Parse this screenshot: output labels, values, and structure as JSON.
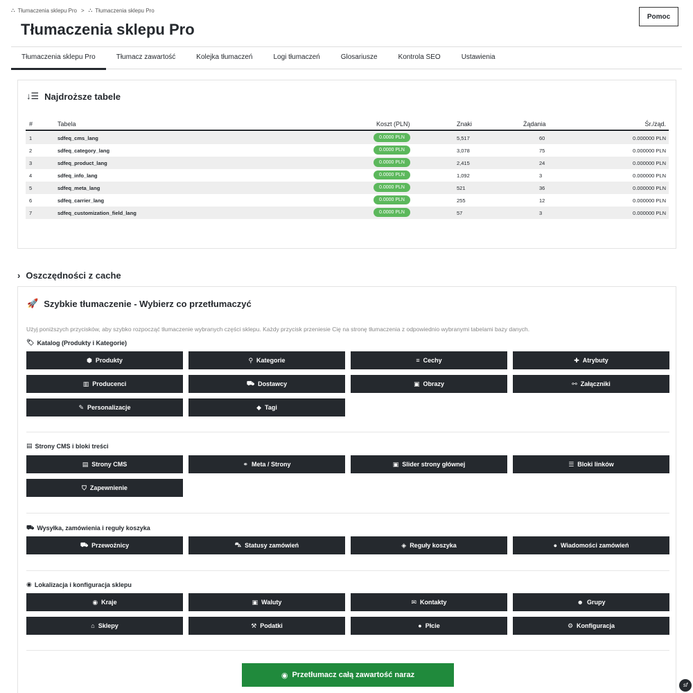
{
  "breadcrumb": [
    "Tłumaczenia sklepu Pro",
    "Tłumaczenia sklepu Pro"
  ],
  "title": "Tłumaczenia sklepu Pro",
  "help_label": "Pomoc",
  "tabs": [
    "Tłumaczenia sklepu Pro",
    "Tłumacz zawartość",
    "Kolejka tłumaczeń",
    "Logi tłumaczeń",
    "Glosariusze",
    "Kontrola SEO",
    "Ustawienia"
  ],
  "expensive": {
    "heading": "Najdroższe tabele",
    "columns": [
      "#",
      "Tabela",
      "Koszt (PLN)",
      "Znaki",
      "Żądania",
      "Śr./żąd."
    ],
    "rows": [
      {
        "n": "1",
        "table": "sdfeq_cms_lang",
        "cost": "0.0000 PLN",
        "chars": "5,517",
        "req": "60",
        "avg": "0.000000 PLN"
      },
      {
        "n": "2",
        "table": "sdfeq_category_lang",
        "cost": "0.0000 PLN",
        "chars": "3,078",
        "req": "75",
        "avg": "0.000000 PLN"
      },
      {
        "n": "3",
        "table": "sdfeq_product_lang",
        "cost": "0.0000 PLN",
        "chars": "2,415",
        "req": "24",
        "avg": "0.000000 PLN"
      },
      {
        "n": "4",
        "table": "sdfeq_info_lang",
        "cost": "0.0000 PLN",
        "chars": "1,092",
        "req": "3",
        "avg": "0.000000 PLN"
      },
      {
        "n": "5",
        "table": "sdfeq_meta_lang",
        "cost": "0.0000 PLN",
        "chars": "521",
        "req": "36",
        "avg": "0.000000 PLN"
      },
      {
        "n": "6",
        "table": "sdfeq_carrier_lang",
        "cost": "0.0000 PLN",
        "chars": "255",
        "req": "12",
        "avg": "0.000000 PLN"
      },
      {
        "n": "7",
        "table": "sdfeq_customization_field_lang",
        "cost": "0.0000 PLN",
        "chars": "57",
        "req": "3",
        "avg": "0.000000 PLN"
      }
    ]
  },
  "cache_heading": "Oszczędności z cache",
  "quick": {
    "heading": "Szybkie tłumaczenie - Wybierz co przetłumaczyć",
    "description": "Użyj poniższych przycisków, aby szybko rozpocząć tłumaczenie wybranych części sklepu. Każdy przycisk przeniesie Cię na stronę tłumaczenia z odpowiednio wybranymi tabelami bazy danych.",
    "groups": [
      {
        "title": "Katalog (Produkty i Kategorie)",
        "buttons": [
          "Produkty",
          "Kategorie",
          "Cechy",
          "Atrybuty",
          "Producenci",
          "Dostawcy",
          "Obrazy",
          "Załączniki",
          "Personalizacje",
          "Tagi"
        ]
      },
      {
        "title": "Strony CMS i bloki treści",
        "buttons": [
          "Strony CMS",
          "Meta / Strony",
          "Slider strony głównej",
          "Bloki linków",
          "Zapewnienie"
        ]
      },
      {
        "title": "Wysyłka, zamówienia i reguły koszyka",
        "buttons": [
          "Przewoźnicy",
          "Statusy zamówień",
          "Reguły koszyka",
          "Wiadomości zamówień"
        ]
      },
      {
        "title": "Lokalizacja i konfiguracja sklepu",
        "buttons": [
          "Kraje",
          "Waluty",
          "Kontakty",
          "Grupy",
          "Sklepy",
          "Podatki",
          "Płcie",
          "Konfiguracja"
        ]
      }
    ],
    "translate_all_label": "Przetłumacz całą zawartość naraz"
  },
  "colors": {
    "dark": "#25292e",
    "green_button": "#208a3c",
    "pill_green": "#5cb85c"
  }
}
